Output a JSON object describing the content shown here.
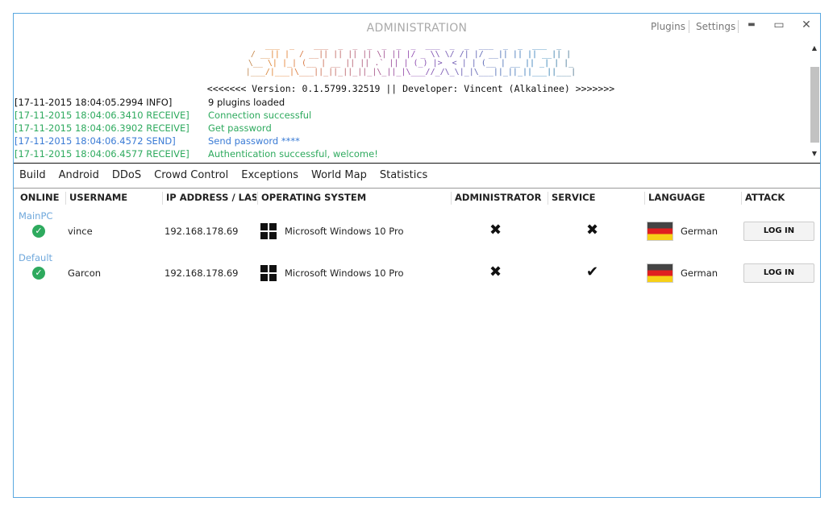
{
  "window": {
    "title": "ADMINISTRATION",
    "plugins_label": "Plugins",
    "settings_label": "Settings",
    "minimize": "▬",
    "maximize": "▭",
    "close": "✕"
  },
  "banner": {
    "art": " ___  _    ___  _  _  _  _  _  _  ___  _  _  ___  _  _  ___  _\n/ __|| |  / __|| || || || \\| || |/ _ \\\\ \\/ /| |/ __|| || || __|| |\n\\__ \\| |_| (__ | __ || || .` || | (_) |>  < | | (__ | __ || _| | |_\n|___/|___|\\___||_||_||_||_|\\_||_|\\___//_/\\_\\|_|\\___||_||_||___||___|",
    "version_line": "<<<<<<< Version: 0.1.5799.32519 || Developer: Vincent (Alkalinee) >>>>>>>"
  },
  "log": [
    {
      "ts": "[17-11-2015 18:04:05.2994 INFO]",
      "msg": "9 plugins loaded",
      "color": "#111111"
    },
    {
      "ts": "[17-11-2015 18:04:06.3410 RECEIVE]",
      "msg": "Connection successful",
      "color": "#2eaa5e"
    },
    {
      "ts": "[17-11-2015 18:04:06.3902 RECEIVE]",
      "msg": "Get password",
      "color": "#2eaa5e"
    },
    {
      "ts": "[17-11-2015 18:04:06.4572 SEND]",
      "msg": "Send password ****",
      "color": "#3a7bd5"
    },
    {
      "ts": "[17-11-2015 18:04:06.4577 RECEIVE]",
      "msg": "Authentication successful, welcome!",
      "color": "#2eaa5e"
    }
  ],
  "tabs": [
    "Build",
    "Android",
    "DDoS",
    "Crowd Control",
    "Exceptions",
    "World Map",
    "Statistics"
  ],
  "columns": [
    "ONLINE",
    "USERNAME",
    "IP ADDRESS / LAST SEEN",
    "OPERATING SYSTEM",
    "ADMINISTRATOR",
    "SERVICE",
    "LANGUAGE",
    "ATTACK"
  ],
  "groups": [
    {
      "name": "MainPC",
      "client": {
        "username": "vince",
        "ip": "192.168.178.69",
        "os": "Microsoft Windows 10 Pro",
        "admin": "✖",
        "service": "✖",
        "language": "German",
        "attack": "LOG IN"
      }
    },
    {
      "name": "Default",
      "client": {
        "username": "Garcon",
        "ip": "192.168.178.69",
        "os": "Microsoft Windows 10 Pro",
        "admin": "✖",
        "service": "✔",
        "language": "German",
        "attack": "LOG IN"
      }
    }
  ]
}
